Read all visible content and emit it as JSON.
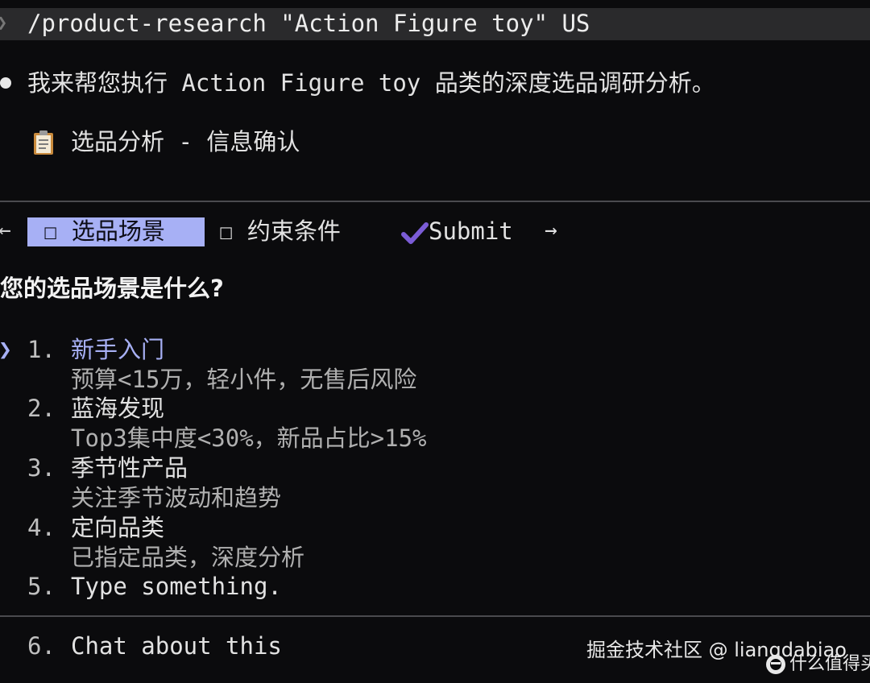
{
  "command": {
    "prompt_symbol": "❯",
    "text": "/product-research \"Action Figure toy\" US"
  },
  "intro_message": "我来帮您执行 Action Figure toy 品类的深度选品调研分析。",
  "section": {
    "icon": "clipboard-icon",
    "title": "选品分析 - 信息确认"
  },
  "tabs": {
    "left_arrow": "←",
    "right_arrow": "→",
    "items": [
      {
        "label": "☐ 选品场景",
        "active": true
      },
      {
        "label": "☐ 约束条件",
        "active": false
      },
      {
        "label": "Submit",
        "icon": "checkmark-icon",
        "active": false
      }
    ]
  },
  "question": "您的选品场景是什么?",
  "pointer": "❯",
  "options": [
    {
      "num": "1.",
      "title": "新手入门",
      "desc": "预算<15万，轻小件，无售后风险",
      "selected": true
    },
    {
      "num": "2.",
      "title": "蓝海发现",
      "desc": "Top3集中度<30%，新品占比>15%",
      "selected": false
    },
    {
      "num": "3.",
      "title": "季节性产品",
      "desc": "关注季节波动和趋势",
      "selected": false
    },
    {
      "num": "4.",
      "title": "定向品类",
      "desc": "已指定品类，深度分析",
      "selected": false
    },
    {
      "num": "5.",
      "title": "Type something.",
      "desc": "",
      "selected": false
    }
  ],
  "chat_option": {
    "num": "6.",
    "title": "Chat about this"
  },
  "watermark": {
    "text": "掘金技术社区 @ liangdabiao",
    "brand": "什么值得买"
  },
  "colors": {
    "accent": "#a7b0f5",
    "check": "#7b5cd6",
    "background": "#0b0b0d",
    "command_bar": "#2a2a2c"
  }
}
